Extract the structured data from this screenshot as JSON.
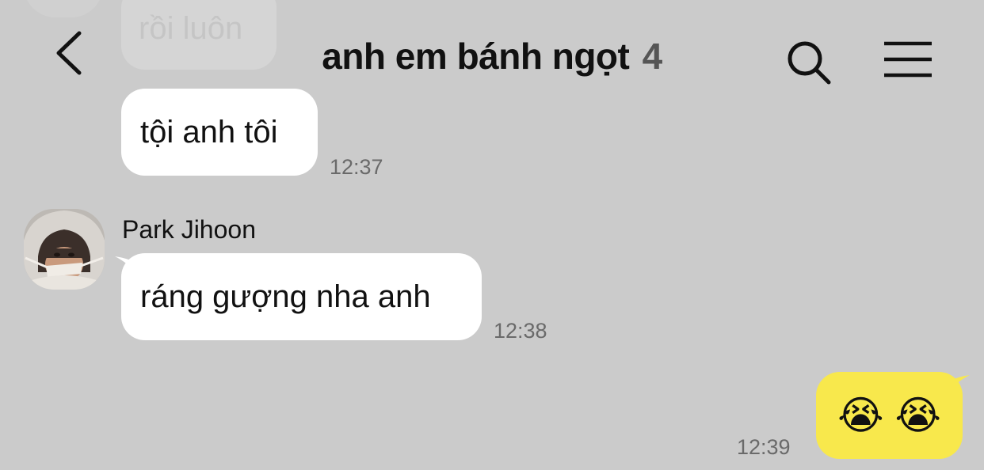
{
  "header": {
    "title": "anh em bánh ngọt",
    "member_count": "4",
    "back_icon": "chevron-left-icon",
    "search_icon": "search-icon",
    "menu_icon": "hamburger-menu-icon"
  },
  "messages": [
    {
      "text": "rồi luôn",
      "faded": true
    },
    {
      "text": "tội anh tôi",
      "time": "12:37"
    },
    {
      "sender": "Park Jihoon",
      "text": "ráng gượng nha anh",
      "time": "12:38"
    },
    {
      "text": "😭 😭",
      "time": "12:39",
      "own": true,
      "bubble_color": "#f8e84c"
    }
  ],
  "colors": {
    "background": "#cbcbcb",
    "bubble_incoming": "#ffffff",
    "bubble_outgoing": "#f8e84c"
  }
}
